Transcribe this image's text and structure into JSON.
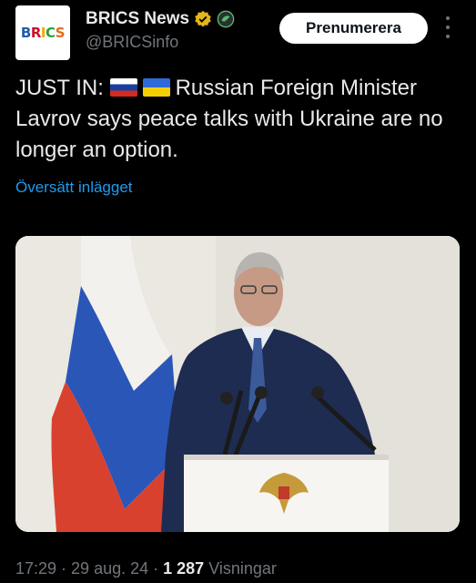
{
  "account": {
    "avatar_letters": [
      "B",
      "R",
      "I",
      "C",
      "S"
    ],
    "display_name": "BRICS News",
    "handle": "@BRICSinfo",
    "subscribe_label": "Prenumerera"
  },
  "post": {
    "text_prefix": "JUST IN:",
    "text_body": "Russian Foreign Minister Lavrov says peace talks with Ukraine are no longer an option.",
    "flags": [
      "russia-flag",
      "ukraine-flag"
    ],
    "translate_label": "Översätt inlägget"
  },
  "meta": {
    "time": "17:29",
    "sep1": " · ",
    "date": "29 aug. 24",
    "sep2": " · ",
    "views_count": "1 287",
    "views_label": "Visningar"
  },
  "colors": {
    "background": "#000000",
    "link": "#1d9bf0",
    "verified_badge": "#e2b719",
    "secondary_text": "#71767b"
  }
}
